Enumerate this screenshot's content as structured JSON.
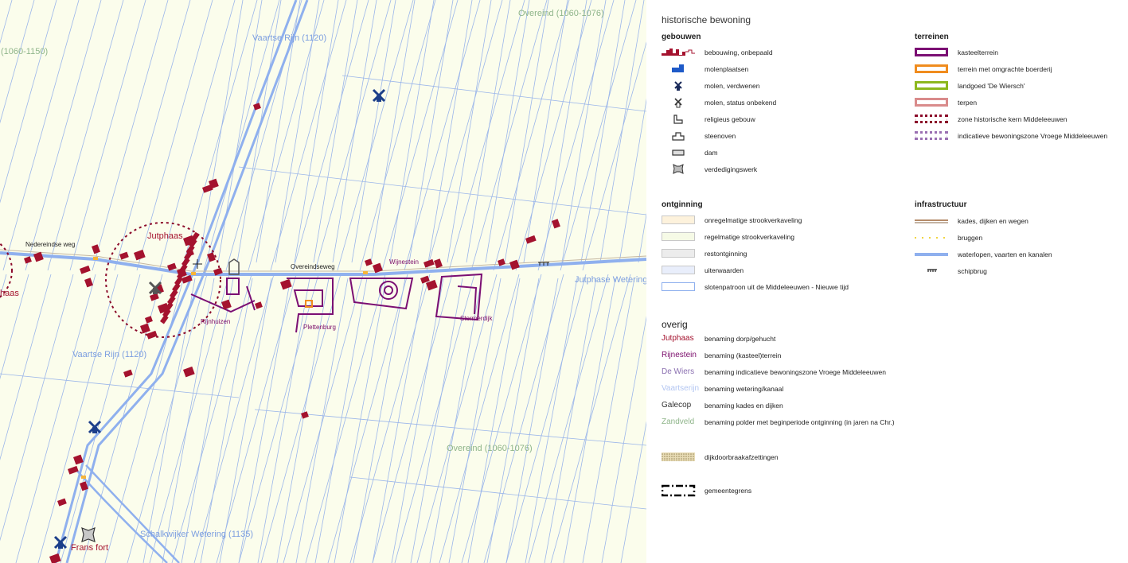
{
  "map": {
    "polder_labels": [
      "Overeind (1060-1076)",
      "(1060-1150)",
      "Overeind (1060-1076)"
    ],
    "water_labels": [
      "Vaartse Rijn (1120)",
      "Vaartse Rijn (1120)",
      "Jutphase Wetering",
      "Schalkwijker Wetering (1135)"
    ],
    "village_labels": [
      "Jutphaas",
      "haas",
      "Frans fort"
    ],
    "estate_labels": [
      "Rijnhuizen",
      "Plettenburg",
      "Wijnestein",
      "Stormerdijk"
    ],
    "road_labels": [
      "Nedereindse weg",
      "Overeindseweg"
    ]
  },
  "legend": {
    "title": "historische bewoning",
    "gebouwen": {
      "heading": "gebouwen",
      "items": [
        {
          "label": "bebouwing, onbepaald",
          "icon": "building-icon"
        },
        {
          "label": "molenplaatsen",
          "icon": "mill-site-icon"
        },
        {
          "label": "molen, verdwenen",
          "icon": "windmill-icon"
        },
        {
          "label": "molen, status onbekend",
          "icon": "windmill-unknown-icon"
        },
        {
          "label": "religieus gebouw",
          "icon": "church-icon"
        },
        {
          "label": "steenoven",
          "icon": "brick-kiln-icon"
        },
        {
          "label": "dam",
          "icon": "dam-icon"
        },
        {
          "label": "verdedigingswerk",
          "icon": "fortification-icon"
        }
      ]
    },
    "terreinen": {
      "heading": "terreinen",
      "items": [
        {
          "label": "kasteelterrein",
          "color": "#7b0f73",
          "style": "solid"
        },
        {
          "label": "terrein met omgrachte boerderij",
          "color": "#f08c1e",
          "style": "solid"
        },
        {
          "label": "landgoed 'De Wiersch'",
          "color": "#8db81e",
          "style": "solid"
        },
        {
          "label": "terpen",
          "color": "#d98b8b",
          "style": "solid"
        },
        {
          "label": "zone historische kern Middeleeuwen",
          "color": "#8b0a2a",
          "style": "dotted"
        },
        {
          "label": "indicatieve bewoningszone Vroege Middeleeuwen",
          "color": "#9a6fb2",
          "style": "dotted"
        }
      ]
    },
    "ontginning": {
      "heading": "ontginning",
      "items": [
        {
          "label": "onregelmatige strookverkaveling",
          "fill": "#fdf2dc"
        },
        {
          "label": "regelmatige strookverkaveling",
          "fill": "#f6fae6"
        },
        {
          "label": "restontginning",
          "fill": "#ececec"
        },
        {
          "label": "uiterwaarden",
          "fill": "#e9eefb"
        },
        {
          "label": "slotenpatroon uit de Middeleeuwen - Nieuwe tijd",
          "fill": "#ffffff"
        }
      ]
    },
    "infrastructuur": {
      "heading": "infrastructuur",
      "items": [
        {
          "label": "kades, dijken en wegen",
          "icon": "road-line"
        },
        {
          "label": "bruggen",
          "icon": "bridge-line"
        },
        {
          "label": "waterlopen, vaarten en kanalen",
          "icon": "water-line"
        },
        {
          "label": "schipbrug",
          "icon": "ship-bridge-icon"
        }
      ]
    },
    "overig": {
      "heading": "overig",
      "names": [
        {
          "tag": "Jutphaas",
          "label": "benaming dorp/gehucht",
          "color": "#a4122e"
        },
        {
          "tag": "Rijnestein",
          "label": "benaming (kasteel)terrein",
          "color": "#7a0b6a"
        },
        {
          "tag": "De Wiers",
          "label": "benaming indicatieve bewoningszone Vroege Middeleeuwen",
          "color": "#8a6fb0"
        },
        {
          "tag": "Vaartserijn",
          "label": "benaming wetering/kanaal",
          "color": "#b3c6f2"
        },
        {
          "tag": "Galecop",
          "label": "benaming kades en dijken",
          "color": "#333333"
        },
        {
          "tag": "Zandveld",
          "label": "benaming polder met beginperiode ontginning (in jaren na Chr.)",
          "color": "#8fb58a"
        }
      ],
      "extra": [
        {
          "label": "dijkdoorbraakafzettingen",
          "icon": "deposit-swatch"
        },
        {
          "label": "gemeentegrens",
          "icon": "municipal-border-line"
        }
      ]
    }
  }
}
